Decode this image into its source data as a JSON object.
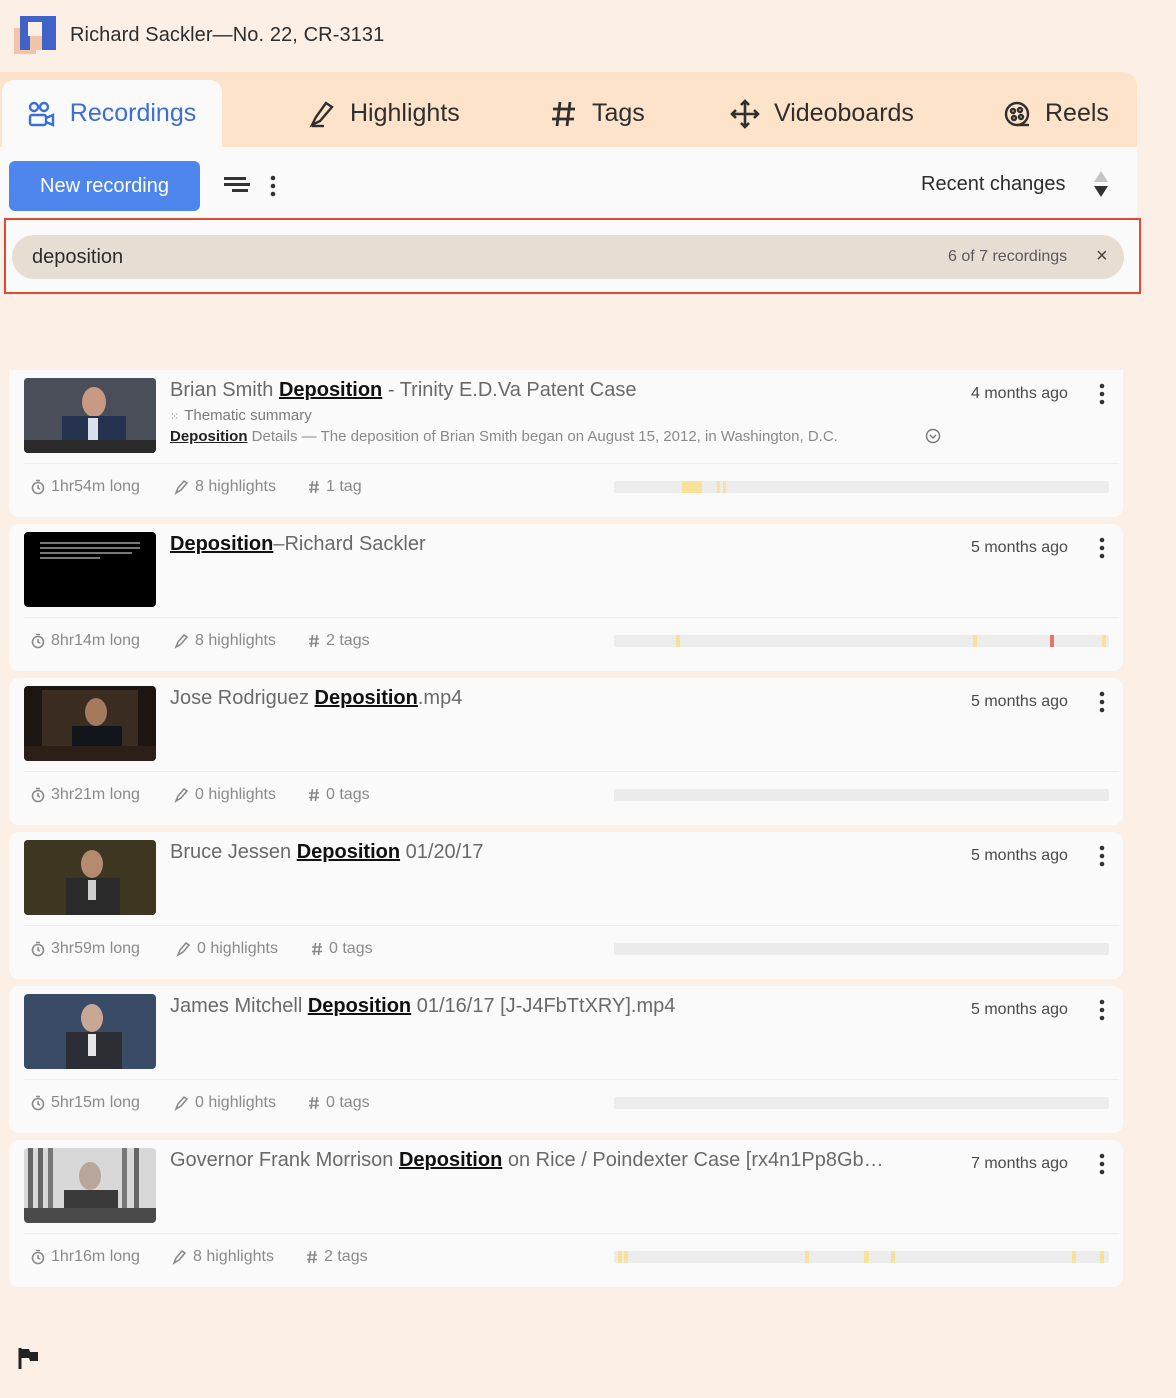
{
  "app": {
    "title": "Richard Sackler—No. 22, CR-3131"
  },
  "tabs": [
    {
      "label": "Recordings",
      "icon": "recordings-icon"
    },
    {
      "label": "Highlights",
      "icon": "highlighter-icon"
    },
    {
      "label": "Tags",
      "icon": "hash-icon"
    },
    {
      "label": "Videoboards",
      "icon": "move-cross-icon"
    },
    {
      "label": "Reels",
      "icon": "film-reel-icon"
    }
  ],
  "toolbar": {
    "new_label": "New recording",
    "sort_label": "Recent changes"
  },
  "search": {
    "value": "deposition",
    "count": "6 of 7 recordings",
    "clear": "×"
  },
  "colors": {
    "accent": "#4f86ee",
    "highlight_yellow": "#f8e29a",
    "highlight_red": "#e0796b"
  },
  "recordings": [
    {
      "title_pre": "Brian Smith ",
      "title_hl": "Deposition",
      "title_post": " - Trinity E.D.Va Patent Case",
      "date": "4 months ago",
      "sub": "Thematic summary",
      "snippet_hl": "Deposition",
      "snippet_rest": " Details — The deposition of Brian Smith began on August 15, 2012, in Washington, D.C.",
      "duration": "1hr54m long",
      "highlights": "8 highlights",
      "tags": "1 tag",
      "marks": [
        {
          "at": 0.137,
          "len": 0.04,
          "c": "y"
        },
        {
          "at": 0.208,
          "len": 0.006,
          "c": "y"
        },
        {
          "at": 0.22,
          "len": 0.006,
          "c": "y"
        }
      ]
    },
    {
      "title_pre": "",
      "title_hl": "Deposition",
      "title_post": "–Richard Sackler",
      "date": "5 months ago",
      "duration": "8hr14m long",
      "highlights": "8 highlights",
      "tags": "2 tags",
      "marks": [
        {
          "at": 0.125,
          "len": 0.008,
          "c": "y"
        },
        {
          "at": 0.725,
          "len": 0.008,
          "c": "y"
        },
        {
          "at": 0.88,
          "len": 0.009,
          "c": "r"
        },
        {
          "at": 0.985,
          "len": 0.008,
          "c": "y"
        }
      ]
    },
    {
      "title_pre": "Jose Rodriguez ",
      "title_hl": "Deposition",
      "title_post": ".mp4",
      "date": "5 months ago",
      "duration": "3hr21m long",
      "highlights": "0 highlights",
      "tags": "0 tags",
      "marks": []
    },
    {
      "title_pre": "Bruce Jessen ",
      "title_hl": "Deposition",
      "title_post": " 01/20/17",
      "date": "5 months ago",
      "duration": "3hr59m long",
      "highlights": "0 highlights",
      "tags": "0 tags",
      "marks": []
    },
    {
      "title_pre": "James Mitchell ",
      "title_hl": "Deposition",
      "title_post": " 01/16/17 [J-J4FbTtXRY].mp4",
      "date": "5 months ago",
      "duration": "5hr15m long",
      "highlights": "0 highlights",
      "tags": "0 tags",
      "marks": []
    },
    {
      "title_pre": "Governor Frank Morrison ",
      "title_hl": "Deposition",
      "title_post": " on Rice / Poindexter Case [rx4n1Pp8Gb…",
      "date": "7 months ago",
      "duration": "1hr16m long",
      "highlights": "8 highlights",
      "tags": "2 tags",
      "marks": [
        {
          "at": 0.008,
          "len": 0.008,
          "c": "y"
        },
        {
          "at": 0.02,
          "len": 0.008,
          "c": "y"
        },
        {
          "at": 0.385,
          "len": 0.008,
          "c": "y"
        },
        {
          "at": 0.505,
          "len": 0.01,
          "c": "y"
        },
        {
          "at": 0.56,
          "len": 0.008,
          "c": "y"
        },
        {
          "at": 0.925,
          "len": 0.008,
          "c": "y"
        },
        {
          "at": 0.982,
          "len": 0.008,
          "c": "y"
        }
      ]
    }
  ]
}
